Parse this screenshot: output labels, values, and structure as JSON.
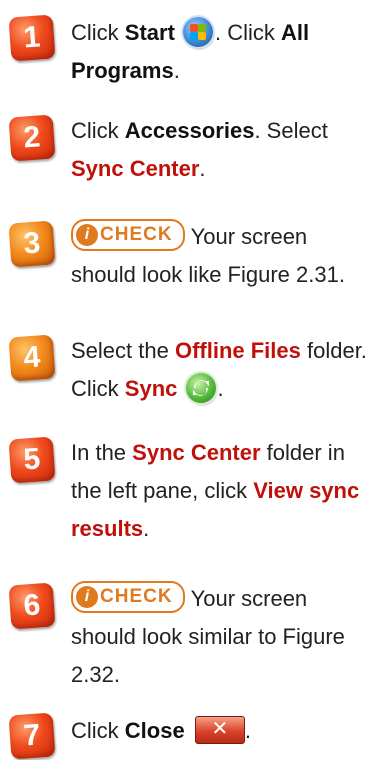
{
  "steps": [
    {
      "num": "1",
      "parts": [
        "Click ",
        "Start",
        ". Click ",
        "All Programs",
        "."
      ]
    },
    {
      "num": "2",
      "parts": [
        "Click ",
        "Accessories",
        ". Select ",
        "Sync Center",
        "."
      ]
    },
    {
      "num": "3",
      "check_label": "CHECK",
      "check_icon": "i",
      "text": "Your screen should look like Figure 2.31."
    },
    {
      "num": "4",
      "parts": [
        "Select the ",
        "Offline Files",
        " folder. Click ",
        "Sync",
        "."
      ]
    },
    {
      "num": "5",
      "parts": [
        "In the ",
        "Sync Center",
        " folder in the left pane, click ",
        "View sync results",
        "."
      ]
    },
    {
      "num": "6",
      "check_label": "CHECK",
      "check_icon": "i",
      "text": "Your screen should look similar to Figure 2.32."
    },
    {
      "num": "7",
      "parts": [
        "Click ",
        "Close",
        "."
      ],
      "close_glyph": "✕"
    }
  ],
  "colors": {
    "step_badge": "#e8421a",
    "step_badge_orange": "#f28a1b",
    "emphasis_red": "#c0100a",
    "check": "#e07a1e"
  },
  "icons": [
    "windows-start-orb-icon",
    "sync-arrow-icon",
    "close-x-icon",
    "check-exclamation-icon"
  ]
}
